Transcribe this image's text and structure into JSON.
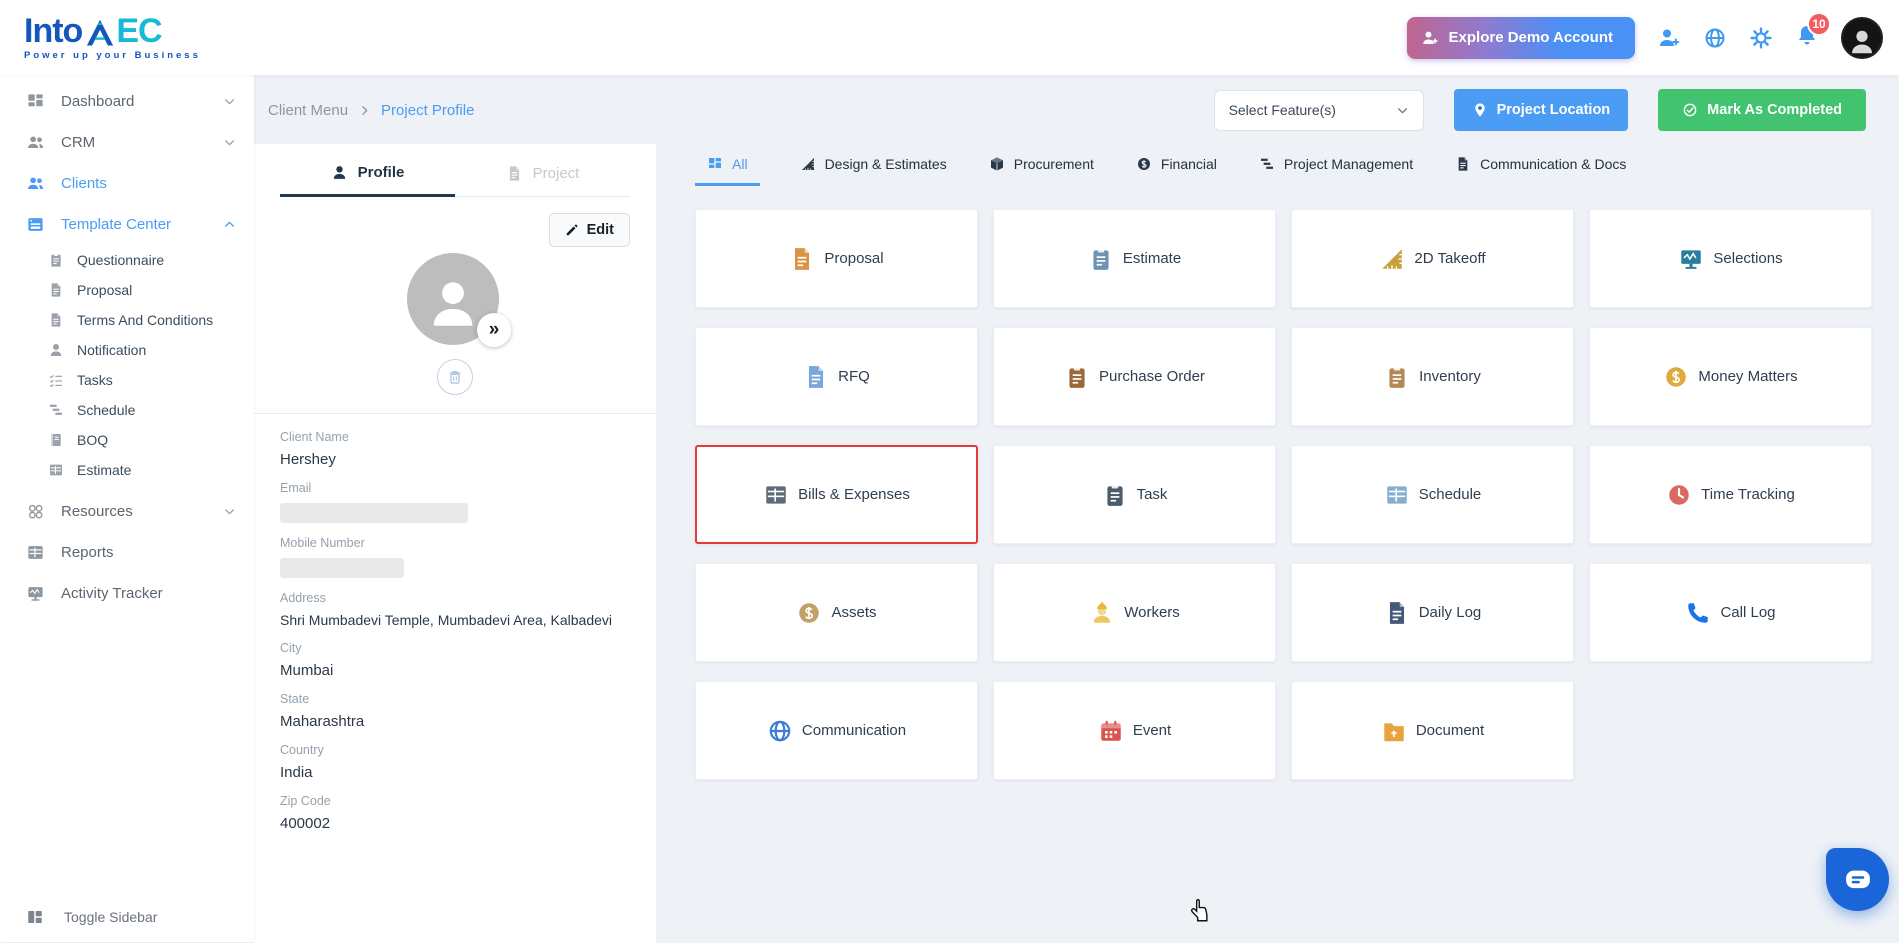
{
  "header": {
    "logo_text_1": "Into",
    "logo_text_2_part": "EC",
    "logo_tagline": "Power up your Business",
    "explore_button_label": "Explore Demo Account",
    "notification_badge": "10"
  },
  "breadcrumb": {
    "parent": "Client Menu",
    "current": "Project Profile"
  },
  "toolbar": {
    "select_features_label": "Select Feature(s)",
    "project_location_label": "Project Location",
    "mark_completed_label": "Mark As Completed"
  },
  "sidebar": {
    "items": [
      {
        "label": "Dashboard"
      },
      {
        "label": "CRM"
      },
      {
        "label": "Clients"
      },
      {
        "label": "Template Center"
      },
      {
        "label": "Resources"
      },
      {
        "label": "Reports"
      },
      {
        "label": "Activity Tracker"
      }
    ],
    "template_children": [
      {
        "label": "Questionnaire"
      },
      {
        "label": "Proposal"
      },
      {
        "label": "Terms And Conditions"
      },
      {
        "label": "Notification"
      },
      {
        "label": "Tasks"
      },
      {
        "label": "Schedule"
      },
      {
        "label": "BOQ"
      },
      {
        "label": "Estimate"
      }
    ],
    "toggle_label": "Toggle Sidebar"
  },
  "profile_panel": {
    "tabs": [
      {
        "label": "Profile"
      },
      {
        "label": "Project"
      }
    ],
    "edit_button_label": "Edit",
    "expand_glyph": "»",
    "fields": [
      {
        "label": "Client Name",
        "value": "Hershey"
      },
      {
        "label": "Email",
        "value": "",
        "redacted": true
      },
      {
        "label": "Mobile Number",
        "value": "",
        "redacted": true
      },
      {
        "label": "Address",
        "value": "Shri Mumbadevi Temple, Mumbadevi Area, Kalbadevi"
      },
      {
        "label": "City",
        "value": "Mumbai"
      },
      {
        "label": "State",
        "value": "Maharashtra"
      },
      {
        "label": "Country",
        "value": "India"
      },
      {
        "label": "Zip Code",
        "value": "400002"
      }
    ]
  },
  "features": {
    "tabs": [
      {
        "label": "All",
        "active": true
      },
      {
        "label": "Design & Estimates"
      },
      {
        "label": "Procurement"
      },
      {
        "label": "Financial"
      },
      {
        "label": "Project Management"
      },
      {
        "label": "Communication & Docs"
      }
    ],
    "cards": [
      {
        "label": "Proposal"
      },
      {
        "label": "Estimate"
      },
      {
        "label": "2D Takeoff"
      },
      {
        "label": "Selections"
      },
      {
        "label": "RFQ"
      },
      {
        "label": "Purchase Order"
      },
      {
        "label": "Inventory"
      },
      {
        "label": "Money Matters"
      },
      {
        "label": "Bills & Expenses",
        "highlighted": true
      },
      {
        "label": "Task"
      },
      {
        "label": "Schedule"
      },
      {
        "label": "Time Tracking"
      },
      {
        "label": "Assets"
      },
      {
        "label": "Workers"
      },
      {
        "label": "Daily Log"
      },
      {
        "label": "Call Log"
      },
      {
        "label": "Communication"
      },
      {
        "label": "Event"
      },
      {
        "label": "Document"
      }
    ]
  },
  "colors": {
    "accent_blue": "#4a9cf5",
    "success_green": "#41c36f",
    "highlight_red": "#e23b3b",
    "badge_red": "#f25b60",
    "chat_blue": "#1a66d9",
    "logo_blue": "#1356bd",
    "logo_teal": "#17b9d6"
  }
}
